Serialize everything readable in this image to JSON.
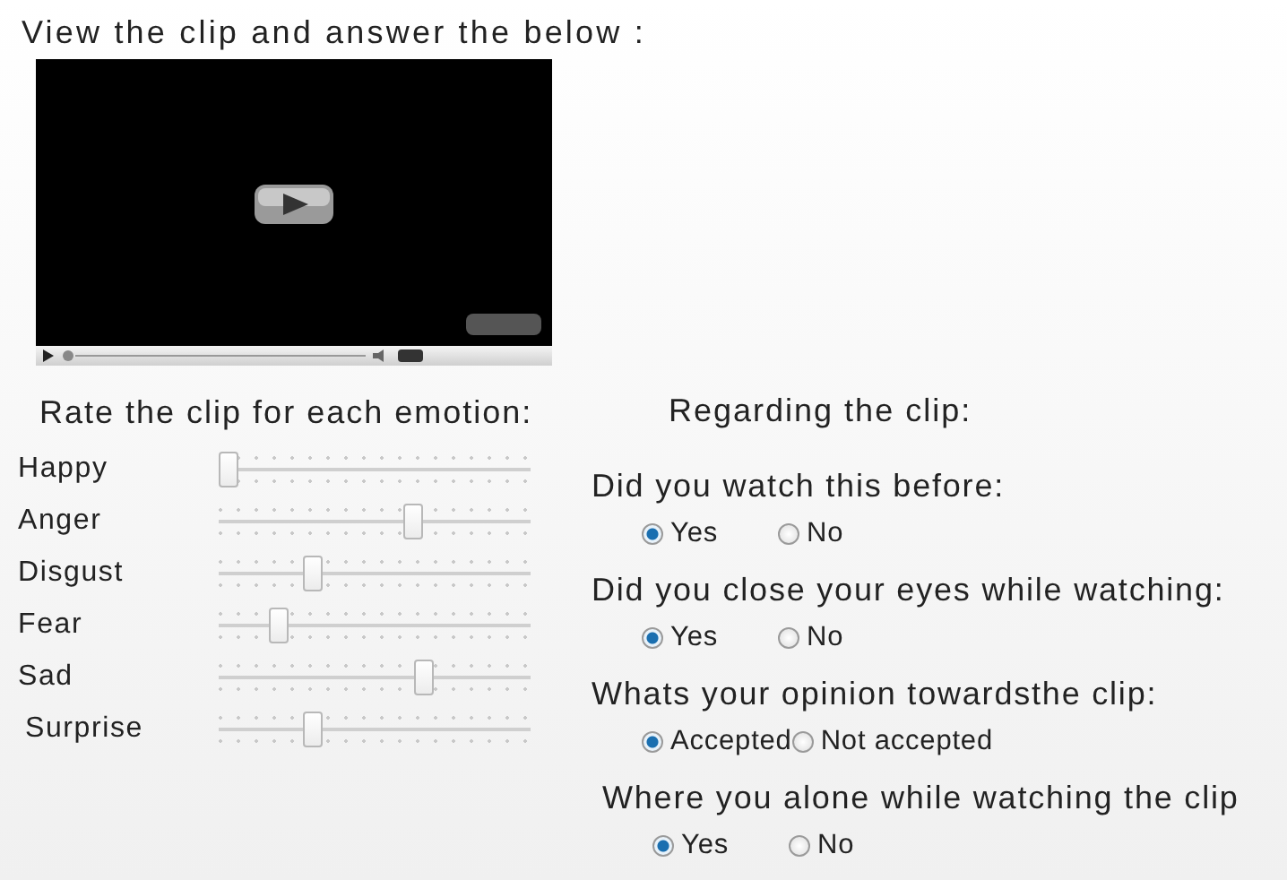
{
  "heading": "View the clip and answer the below :",
  "emotions": {
    "title": "Rate the clip for each emotion:",
    "sliders": [
      {
        "name": "Happy",
        "level": 0.0
      },
      {
        "name": "Anger",
        "level": 0.63
      },
      {
        "name": "Disgust",
        "level": 0.29
      },
      {
        "name": "Fear",
        "level": 0.17
      },
      {
        "name": "Sad",
        "level": 0.67
      },
      {
        "name": "Surprise",
        "level": 0.29
      }
    ]
  },
  "regarding": {
    "title": "Regarding the clip:",
    "questions": [
      {
        "text": "Did you watch this before:",
        "options": [
          {
            "label": "Yes",
            "selected": true
          },
          {
            "label": "No",
            "selected": false
          }
        ]
      },
      {
        "text": "Did you close your eyes while watching:",
        "options": [
          {
            "label": "Yes",
            "selected": true
          },
          {
            "label": "No",
            "selected": false
          }
        ]
      },
      {
        "text": "Whats your opinion towardsthe clip:",
        "options": [
          {
            "label": "Accepted",
            "selected": true
          },
          {
            "label": "Not accepted",
            "selected": false
          }
        ]
      },
      {
        "text": "Where you alone while watching the clip",
        "options": [
          {
            "label": "Yes",
            "selected": true
          },
          {
            "label": "No",
            "selected": false
          }
        ]
      }
    ]
  }
}
